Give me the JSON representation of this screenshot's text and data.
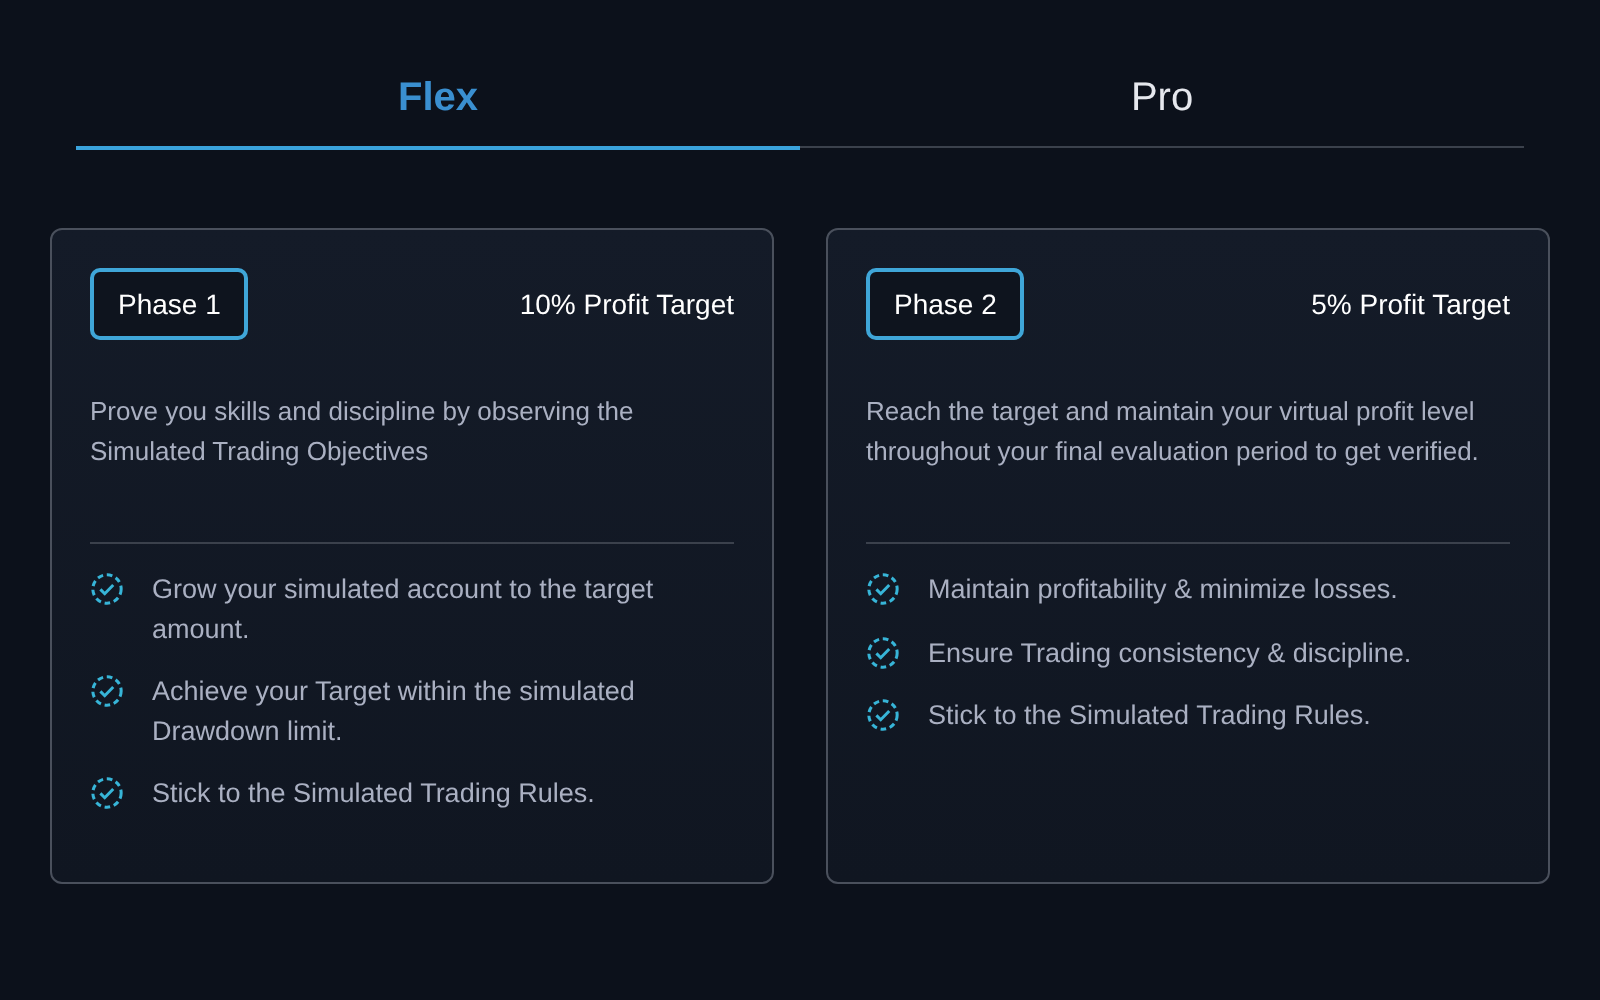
{
  "tabs": [
    {
      "label": "Flex",
      "selected": true
    },
    {
      "label": "Pro",
      "selected": false
    }
  ],
  "phases": [
    {
      "badge": "Phase 1",
      "target": "10% Profit Target",
      "description": "Prove you skills and discipline by observing the Simulated Trading Objectives",
      "objectives": [
        "Grow your simulated account to the target amount.",
        "Achieve your Target within the simulated Drawdown limit.",
        "Stick to the Simulated Trading Rules."
      ]
    },
    {
      "badge": "Phase 2",
      "target": "5% Profit Target",
      "description": "Reach the target and maintain your virtual profit level throughout your final evaluation period to get verified.",
      "objectives": [
        "Maintain profitability & minimize losses.",
        "Ensure Trading consistency & discipline.",
        "Stick to the Simulated Trading Rules."
      ]
    }
  ]
}
